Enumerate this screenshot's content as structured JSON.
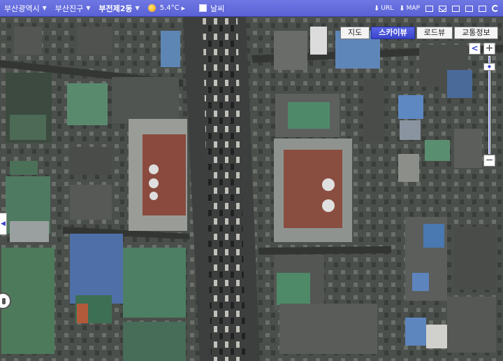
{
  "toolbar": {
    "breadcrumbs": [
      {
        "label": "부산광역시"
      },
      {
        "label": "부산진구"
      },
      {
        "label": "부전제2동"
      }
    ],
    "weather": {
      "icon": "sun-icon",
      "temperature": "5.4°C"
    },
    "weather_toggle_label": "날씨",
    "tools": [
      {
        "label": "URL",
        "icon": "download-icon"
      },
      {
        "label": "MAP",
        "icon": "download-icon"
      }
    ]
  },
  "map_tabs": [
    {
      "label": "지도",
      "active": false
    },
    {
      "label": "스카이뷰",
      "active": true
    },
    {
      "label": "로드뷰",
      "active": false
    },
    {
      "label": "교통정보",
      "active": false
    }
  ],
  "zoom": {
    "plus": "+",
    "minus": "−",
    "pan_left": "<"
  },
  "colors": {
    "toolbar": "#5a62d6",
    "active_tab": "#3a44c9"
  }
}
